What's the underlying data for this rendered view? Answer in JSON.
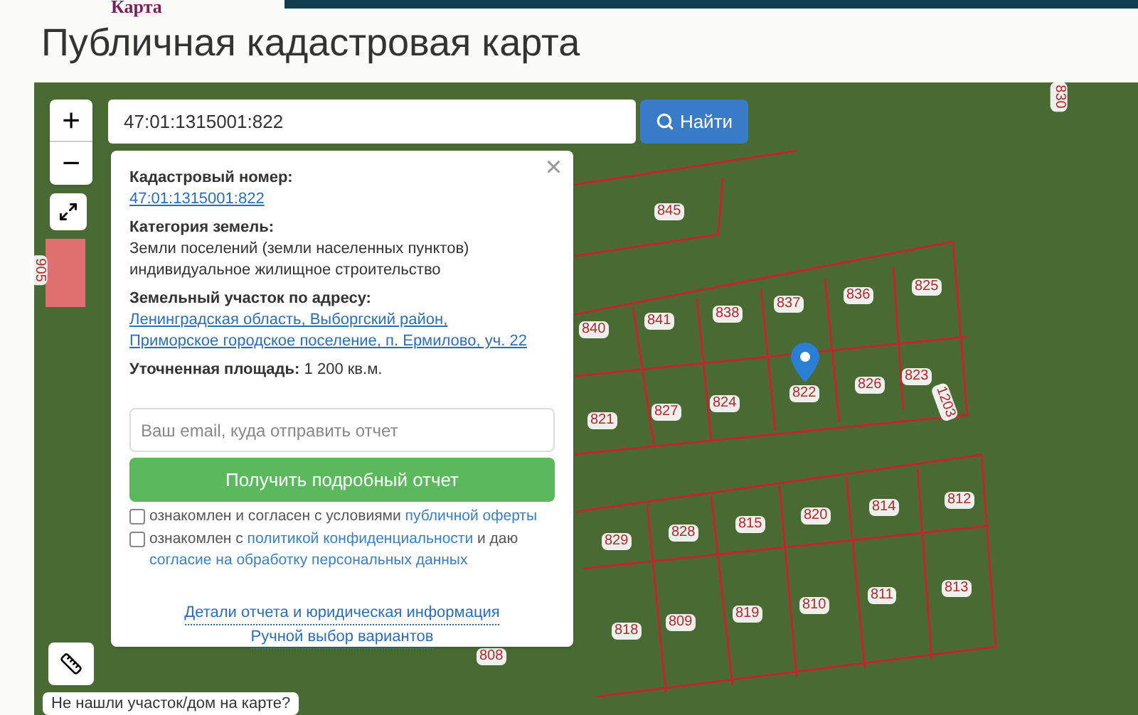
{
  "header": {
    "logo_text": "Карта",
    "title": "Публичная кадастровая карта"
  },
  "map": {
    "zoom_in": "+",
    "zoom_out": "−",
    "search": {
      "value": "47:01:1315001:822",
      "button": "Найти"
    },
    "parcels": [
      "845",
      "840",
      "841",
      "838",
      "837",
      "836",
      "825",
      "821",
      "827",
      "824",
      "822",
      "826",
      "823",
      "1203",
      "829",
      "828",
      "815",
      "820",
      "814",
      "812",
      "818",
      "809",
      "819",
      "810",
      "811",
      "813",
      "808",
      "905",
      "830"
    ],
    "popup": {
      "close": "×",
      "fields": [
        {
          "label": "Кадастровый номер:",
          "value": "47:01:1315001:822",
          "kind": "link"
        },
        {
          "label": "Категория земель:",
          "value": "Земли поселений (земли населенных пунктов)",
          "extra": "индивидуальное жилищное строительство",
          "kind": "text"
        },
        {
          "label": "Земельный участок по адресу:",
          "value": "Ленинградская область, Выборгский район, Приморское городское поселение, п. Ермилово, уч. 22",
          "kind": "link"
        },
        {
          "label": "Уточненная площадь:",
          "value": "1 200 кв.м.",
          "kind": "text"
        }
      ],
      "email": {
        "placeholder": "Ваш email, куда отправить отчет"
      },
      "submit": "Получить подробный отчет",
      "agreements": [
        {
          "checked": false,
          "parts": [
            {
              "text": "ознакомлен и согласен с условиями ",
              "link": false
            },
            {
              "text": "публичной оферты",
              "link": true
            }
          ]
        },
        {
          "checked": false,
          "parts": [
            {
              "text": "ознакомлен с ",
              "link": false
            },
            {
              "text": "политикой конфиденциальности",
              "link": true
            },
            {
              "text": " и даю ",
              "link": false
            },
            {
              "text": "согласие на обработку персональных данных",
              "link": true
            }
          ]
        }
      ],
      "footer_links": [
        "Детали отчета и юридическая информация",
        "Ручной выбор вариантов"
      ]
    },
    "bottom_notice": "Не нашли участок/дом на карте?"
  }
}
